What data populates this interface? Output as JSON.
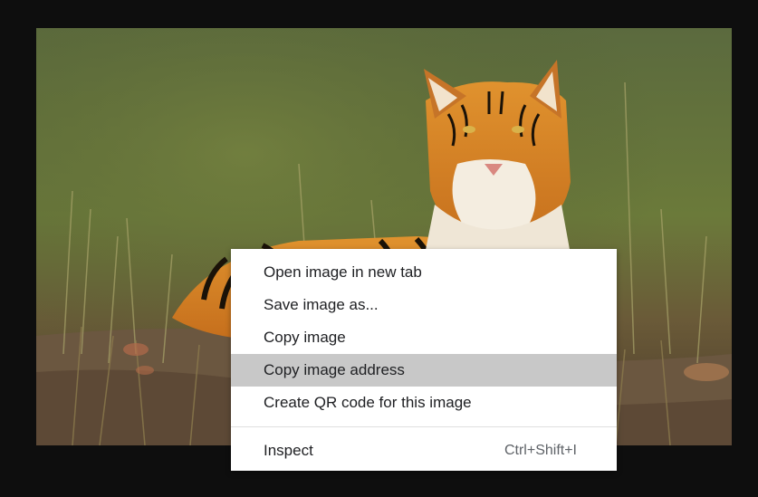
{
  "image": {
    "subject_icon": "tiger-photo"
  },
  "context_menu": {
    "items": [
      {
        "label": "Open image in new tab",
        "shortcut": ""
      },
      {
        "label": "Save image as...",
        "shortcut": ""
      },
      {
        "label": "Copy image",
        "shortcut": ""
      },
      {
        "label": "Copy image address",
        "shortcut": "",
        "highlighted": true
      },
      {
        "label": "Create QR code for this image",
        "shortcut": ""
      }
    ],
    "inspect": {
      "label": "Inspect",
      "shortcut": "Ctrl+Shift+I"
    }
  },
  "colors": {
    "background": "#0e0e0e",
    "menu_bg": "#ffffff",
    "highlight": "#c8c8c8",
    "text": "#202124"
  }
}
